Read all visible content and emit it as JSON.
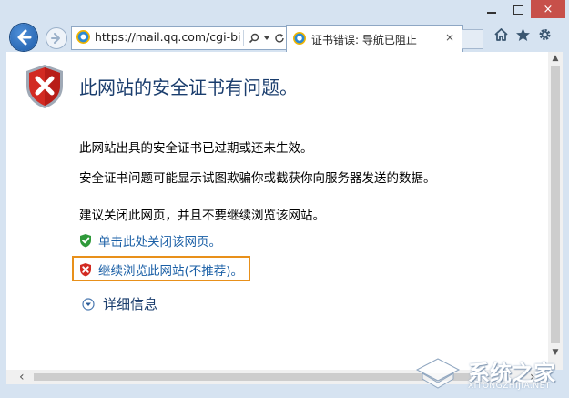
{
  "browser": {
    "url": "https://mail.qq.com/cgi-bi",
    "tab_title": "证书错误: 导航已阻止",
    "tab_close": "×",
    "window_controls": {
      "minimize": "minimize-icon",
      "maximize": "maximize-icon",
      "close": "×"
    }
  },
  "page": {
    "heading": "此网站的安全证书有问题。",
    "paragraphs": [
      "此网站出具的安全证书已过期或还未生效。",
      "安全证书问题可能显示试图欺骗你或截获你向服务器发送的数据。",
      "建议关闭此网页，并且不要继续浏览该网站。"
    ],
    "close_link": "单击此处关闭该网页。",
    "continue_link": "继续浏览此网站(不推荐)。",
    "details_label": "详细信息"
  },
  "watermark": {
    "text": "系统之家",
    "sub": "XITONGZHIJIA.NET"
  },
  "colors": {
    "heading": "#1a3d6d",
    "link": "#1a5fa6",
    "highlight_box": "#e8901a",
    "close_button": "#c7504a"
  },
  "icons": {
    "back": "back-arrow-icon",
    "forward": "forward-arrow-icon",
    "search": "search-icon",
    "refresh": "refresh-icon",
    "dropdown": "dropdown-icon",
    "home": "home-icon",
    "favorites": "star-icon",
    "settings": "gear-icon",
    "error_shield": "red-shield-x-icon",
    "safe_shield": "green-shield-check-icon",
    "unsafe_shield": "red-shield-x-small-icon",
    "expand": "chevron-down-circle-icon"
  }
}
